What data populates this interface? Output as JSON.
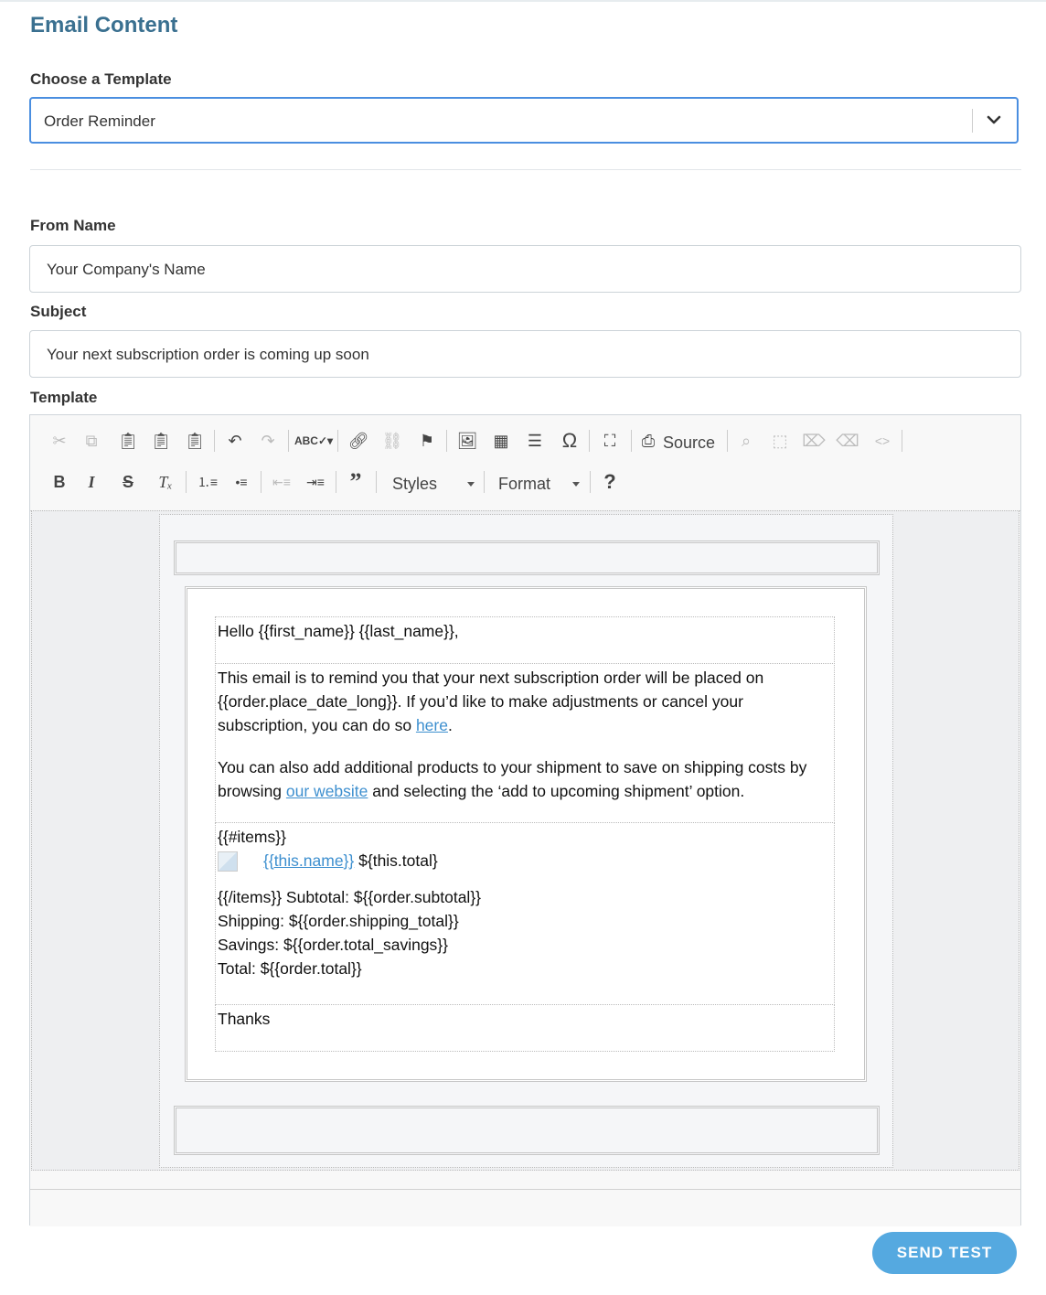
{
  "section": {
    "title": "Email Content"
  },
  "template_select": {
    "label": "Choose a Template",
    "value": "Order Reminder"
  },
  "from_name": {
    "label": "From Name",
    "value": "Your Company's Name"
  },
  "subject": {
    "label": "Subject",
    "value": "Your next subscription order is coming up soon"
  },
  "template_editor": {
    "label": "Template",
    "toolbar": {
      "source_label": "Source",
      "styles_label": "Styles",
      "format_label": "Format"
    },
    "email": {
      "greeting": "Hello {{first_name}} {{last_name}},",
      "para1_before": "This email is to remind you that your next subscription order will be placed on {{order.place_date_long}}. If you’d like to make adjustments or cancel your subscription, you can do so ",
      "para1_link": "here",
      "para1_after": ".",
      "para2_before": "You can also add additional products to your shipment to save on shipping costs by browsing ",
      "para2_link": "our website",
      "para2_after": " and selecting the ‘add to upcoming shipment’ option.",
      "items_open": "{{#items}}",
      "item_name_link": "{{this.name}}",
      "item_total": "${this.total}",
      "items_close_subtotal": "{{/items}} Subtotal: ${{order.subtotal}}",
      "shipping": "Shipping: ${{order.shipping_total}}",
      "savings": "Savings: ${{order.total_savings}}",
      "total": "Total: ${{order.total}}",
      "closing": "Thanks"
    }
  },
  "actions": {
    "send_test_label": "SEND TEST"
  },
  "colors": {
    "title": "#3a7090",
    "focus_border": "#4a8ee0",
    "link": "#3d8fcf",
    "button": "#55a9e0"
  }
}
